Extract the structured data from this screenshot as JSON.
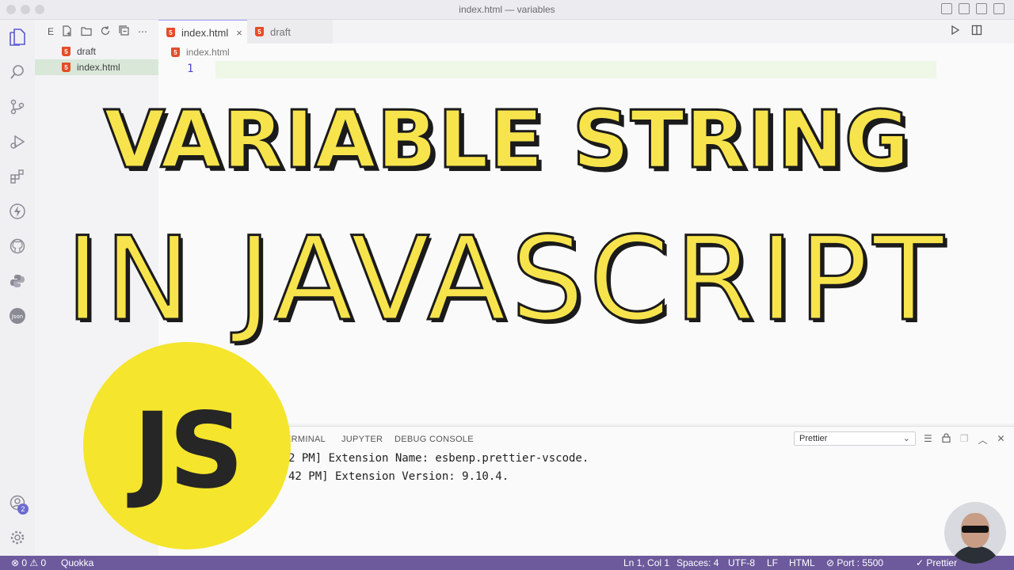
{
  "window": {
    "title": "index.html — variables"
  },
  "sidebar": {
    "toolbar_label": "E",
    "files": [
      {
        "name": "draft",
        "active": false
      },
      {
        "name": "index.html",
        "active": true
      }
    ]
  },
  "tabs": [
    {
      "label": "index.html",
      "active": true,
      "close": "×"
    },
    {
      "label": "draft",
      "active": false
    }
  ],
  "editor": {
    "breadcrumb": "index.html",
    "line_number": "1"
  },
  "overlay": {
    "line1": "VARIABLE STRING",
    "line2": "IN JAVASCRIPT",
    "logo_text": "JS"
  },
  "panel": {
    "tabs": [
      "ERMINAL",
      "JUPYTER",
      "DEBUG CONSOLE"
    ],
    "select_value": "Prettier",
    "output": [
      "2 PM] Extension Name: esbenp.prettier-vscode.",
      "42 PM] Extension Version: 9.10.4."
    ]
  },
  "activity_badge": "2",
  "statusbar": {
    "errors": "⊗ 0 ⚠ 0",
    "quokka": "Quokka",
    "position": "Ln 1, Col 1",
    "spaces": "Spaces: 4",
    "encoding": "UTF-8",
    "eol": "LF",
    "language": "HTML",
    "port": "⊘ Port : 5500",
    "prettier": "✓ Prettier"
  },
  "colors": {
    "accent": "#f7e44d",
    "status_bar": "#6c5a9c",
    "html_icon": "#e44d26"
  }
}
